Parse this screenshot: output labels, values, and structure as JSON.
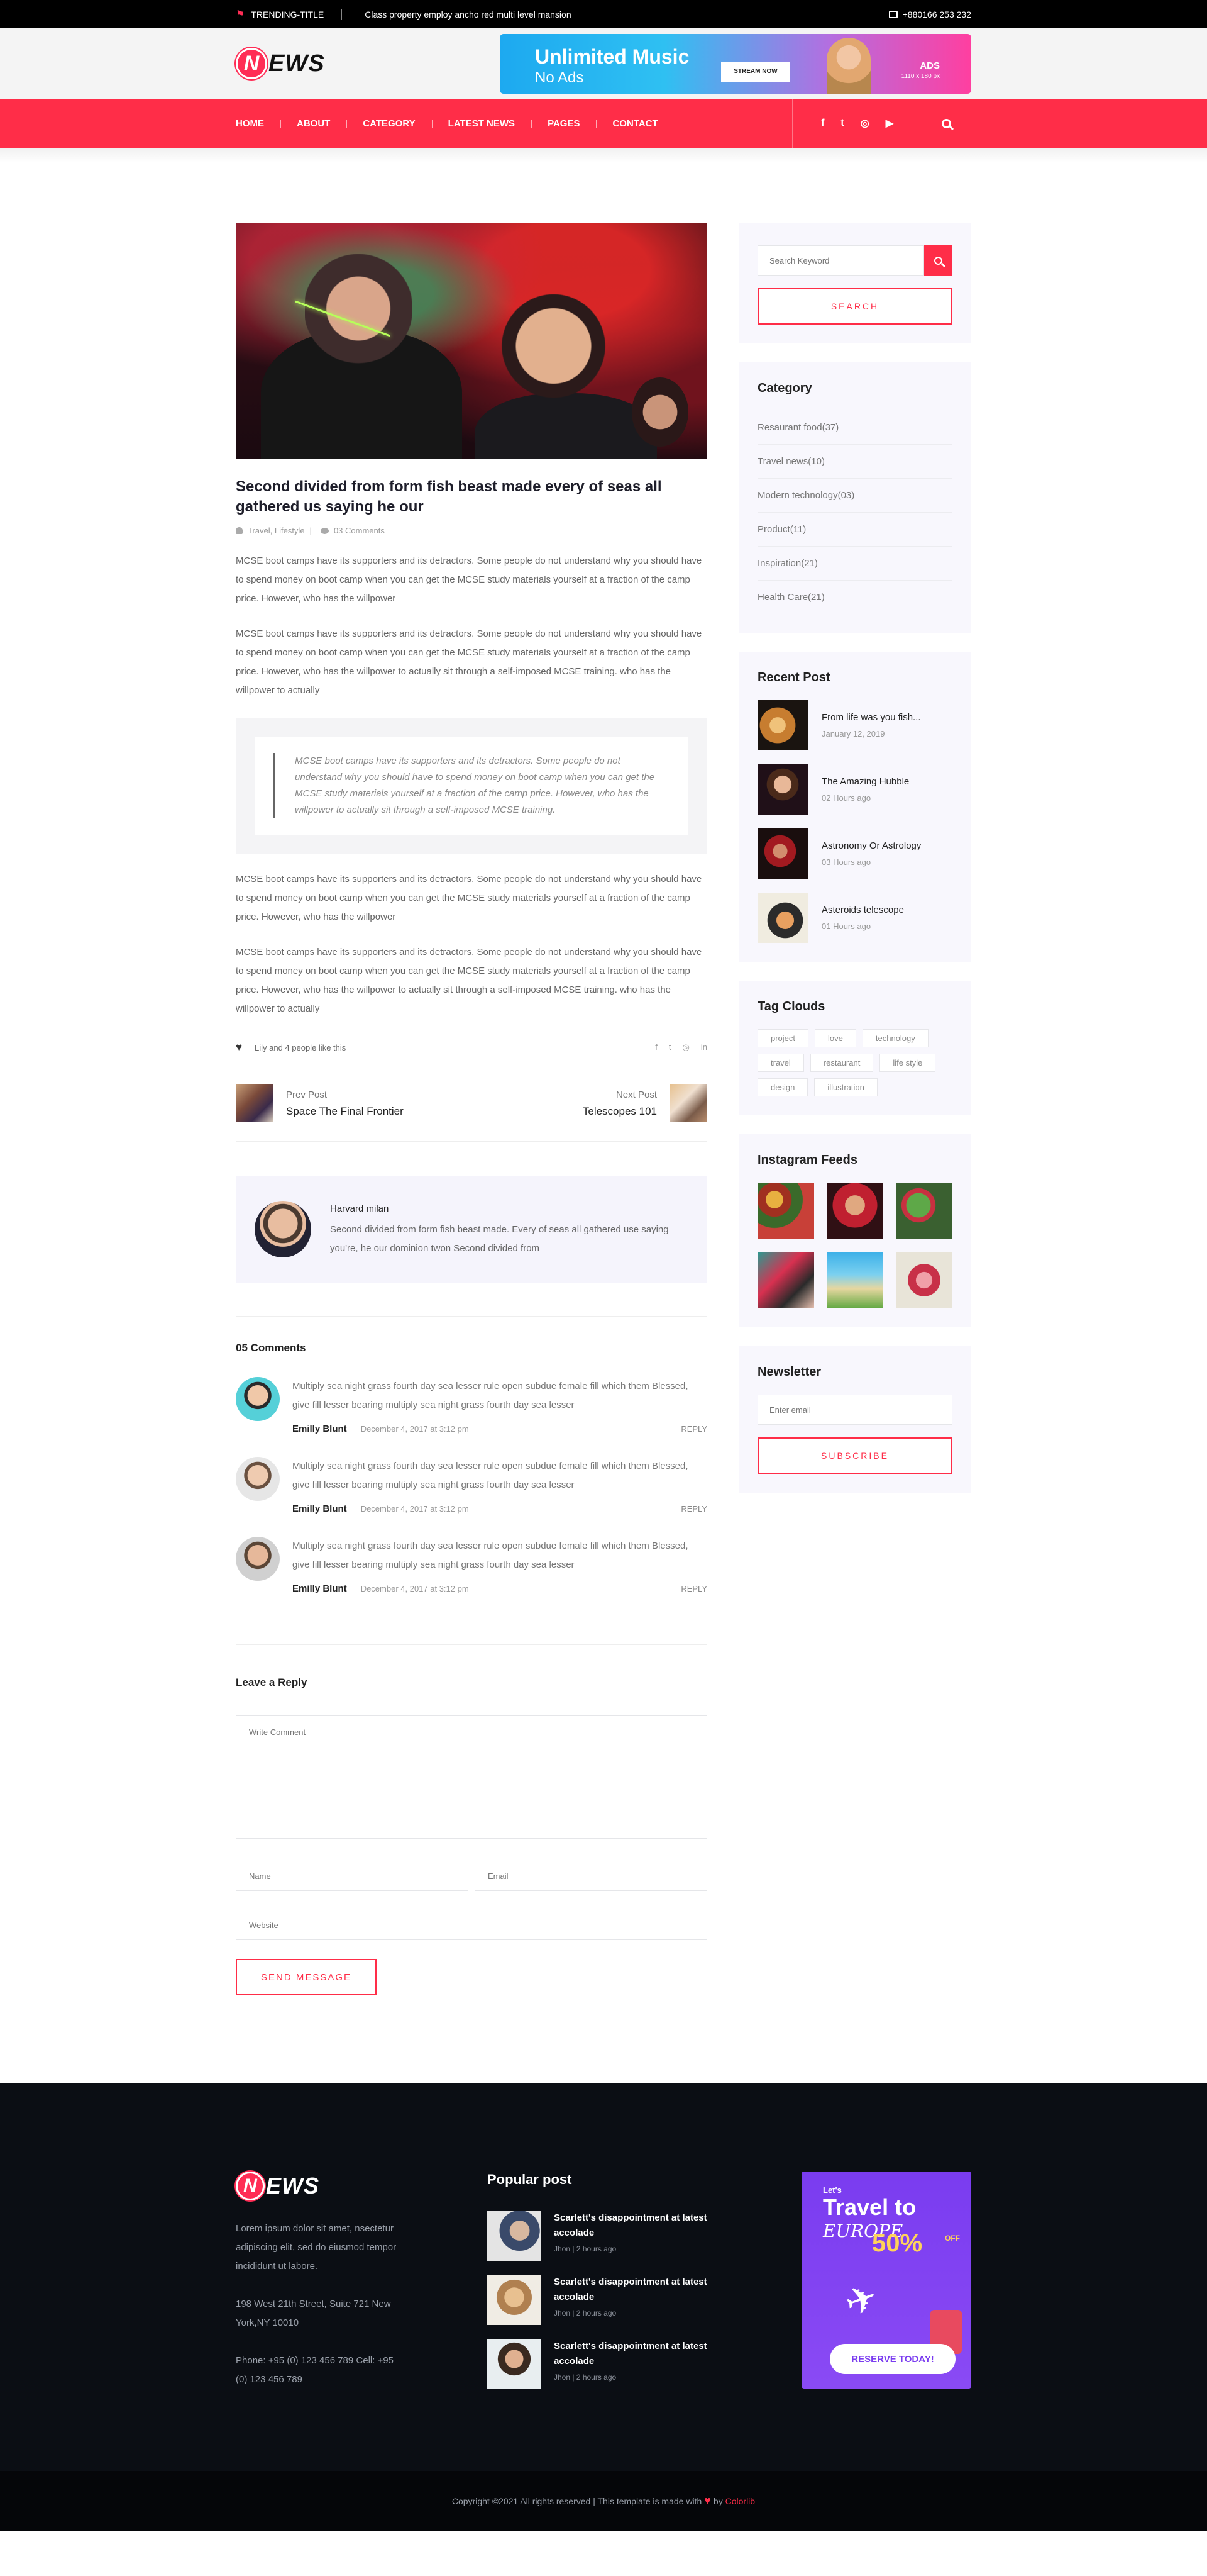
{
  "topbar": {
    "trending_label": "TRENDING-TITLE",
    "trending_text": "Class property employ ancho red multi level mansion",
    "phone": "+880166 253 232"
  },
  "header": {
    "logo_first": "N",
    "logo_rest": "EWS",
    "ad": {
      "title": "Unlimited Music",
      "subtitle": "No Ads",
      "button": "STREAM NOW",
      "label": "ADS",
      "size_text": "1110 x 180 px"
    }
  },
  "nav": {
    "items": [
      {
        "label": "HOME"
      },
      {
        "label": "ABOUT"
      },
      {
        "label": "CATEGORY"
      },
      {
        "label": "LATEST NEWS"
      },
      {
        "label": "PAGES"
      },
      {
        "label": "CONTACT"
      }
    ],
    "social": [
      "facebook-icon",
      "twitter-icon",
      "instagram-icon",
      "youtube-icon"
    ],
    "social_glyphs": [
      "f",
      "t",
      "◎",
      "▶"
    ]
  },
  "post": {
    "title": "Second divided from form fish beast made every of seas all gathered us saying he our",
    "categories": "Travel, Lifestyle",
    "comments": "03 Comments",
    "paragraphs": [
      "MCSE boot camps have its supporters and its detractors. Some people do not understand why you should have to spend money on boot camp when you can get the MCSE study materials yourself at a fraction of the camp price. However, who has the willpower",
      "MCSE boot camps have its supporters and its detractors. Some people do not understand why you should have to spend money on boot camp when you can get the MCSE study materials yourself at a fraction of the camp price. However, who has the willpower to actually sit through a self-imposed MCSE training. who has the willpower to actually",
      "MCSE boot camps have its supporters and its detractors. Some people do not understand why you should have to spend money on boot camp when you can get the MCSE study materials yourself at a fraction of the camp price. However, who has the willpower",
      "MCSE boot camps have its supporters and its detractors. Some people do not understand why you should have to spend money on boot camp when you can get the MCSE study materials yourself at a fraction of the camp price. However, who has the willpower to actually sit through a self-imposed MCSE training. who has the willpower to actually"
    ],
    "quote": "MCSE boot camps have its supporters and its detractors. Some people do not understand why you should have to spend money on boot camp when you can get the MCSE study materials yourself at a fraction of the camp price. However, who has the willpower to actually sit through a self-imposed MCSE training.",
    "likes": "Lily and 4 people like this",
    "share_icons": [
      "f",
      "t",
      "◎",
      "in"
    ]
  },
  "post_nav": {
    "prev_label": "Prev Post",
    "prev_title": "Space The Final Frontier",
    "next_label": "Next Post",
    "next_title": "Telescopes 101"
  },
  "author": {
    "name": "Harvard milan",
    "bio": "Second divided from form fish beast made. Every of seas all gathered use saying you're, he our dominion twon Second divided from"
  },
  "comments": {
    "heading": "05 Comments",
    "items": [
      {
        "text": "Multiply sea night grass fourth day sea lesser rule open subdue female fill which them Blessed, give fill lesser bearing multiply sea night grass fourth day sea lesser",
        "author": "Emilly Blunt",
        "date": "December 4, 2017 at 3:12 pm",
        "reply": "reply"
      },
      {
        "text": "Multiply sea night grass fourth day sea lesser rule open subdue female fill which them Blessed, give fill lesser bearing multiply sea night grass fourth day sea lesser",
        "author": "Emilly Blunt",
        "date": "December 4, 2017 at 3:12 pm",
        "reply": "reply"
      },
      {
        "text": "Multiply sea night grass fourth day sea lesser rule open subdue female fill which them Blessed, give fill lesser bearing multiply sea night grass fourth day sea lesser",
        "author": "Emilly Blunt",
        "date": "December 4, 2017 at 3:12 pm",
        "reply": "reply"
      }
    ]
  },
  "reply_form": {
    "heading": "Leave a Reply",
    "comment_placeholder": "Write Comment",
    "name_placeholder": "Name",
    "email_placeholder": "Email",
    "website_placeholder": "Website",
    "send_label": "Send Message"
  },
  "sidebar": {
    "search_placeholder": "Search Keyword",
    "search_button": "Search",
    "category_title": "Category",
    "categories": [
      "Resaurant food(37)",
      "Travel news(10)",
      "Modern technology(03)",
      "Product(11)",
      "Inspiration(21)",
      "Health Care(21)"
    ],
    "recent_title": "Recent Post",
    "recent": [
      {
        "title": "From life was you fish...",
        "date": "January 12, 2019"
      },
      {
        "title": "The Amazing Hubble",
        "date": "02 Hours ago"
      },
      {
        "title": "Astronomy Or Astrology",
        "date": "03 Hours ago"
      },
      {
        "title": "Asteroids telescope",
        "date": "01 Hours ago"
      }
    ],
    "tags_title": "Tag Clouds",
    "tags": [
      "project",
      "love",
      "technology",
      "travel",
      "restaurant",
      "life style",
      "design",
      "illustration"
    ],
    "insta_title": "Instagram Feeds",
    "newsletter_title": "Newsletter",
    "newsletter_placeholder": "Enter email",
    "subscribe_label": "Subscribe"
  },
  "footer": {
    "about": "Lorem ipsum dolor sit amet, nsectetur adipiscing elit, sed do eiusmod tempor incididunt ut labore.",
    "address": "198 West 21th Street, Suite 721 New York,NY 10010",
    "phone": "Phone: +95 (0) 123 456 789 Cell: +95 (0) 123 456 789",
    "popular_title": "Popular post",
    "popular": [
      {
        "title": "Scarlett's disappointment at latest accolade",
        "meta": "Jhon | 2 hours ago"
      },
      {
        "title": "Scarlett's disappointment at latest accolade",
        "meta": "Jhon | 2 hours ago"
      },
      {
        "title": "Scarlett's disappointment at latest accolade",
        "meta": "Jhon | 2 hours ago"
      }
    ],
    "ad": {
      "lets": "Let's",
      "travel": "Travel to",
      "europe": "EUROPE",
      "percent": "50%",
      "off": "OFF",
      "button": "Reserve Today!"
    }
  },
  "copyright": {
    "text": "Copyright ©2021 All rights reserved | This template is made with",
    "by": "by",
    "brand": "Colorlib"
  },
  "colors": {
    "accent": "#ff2d48",
    "dark": "#0b0e14"
  }
}
